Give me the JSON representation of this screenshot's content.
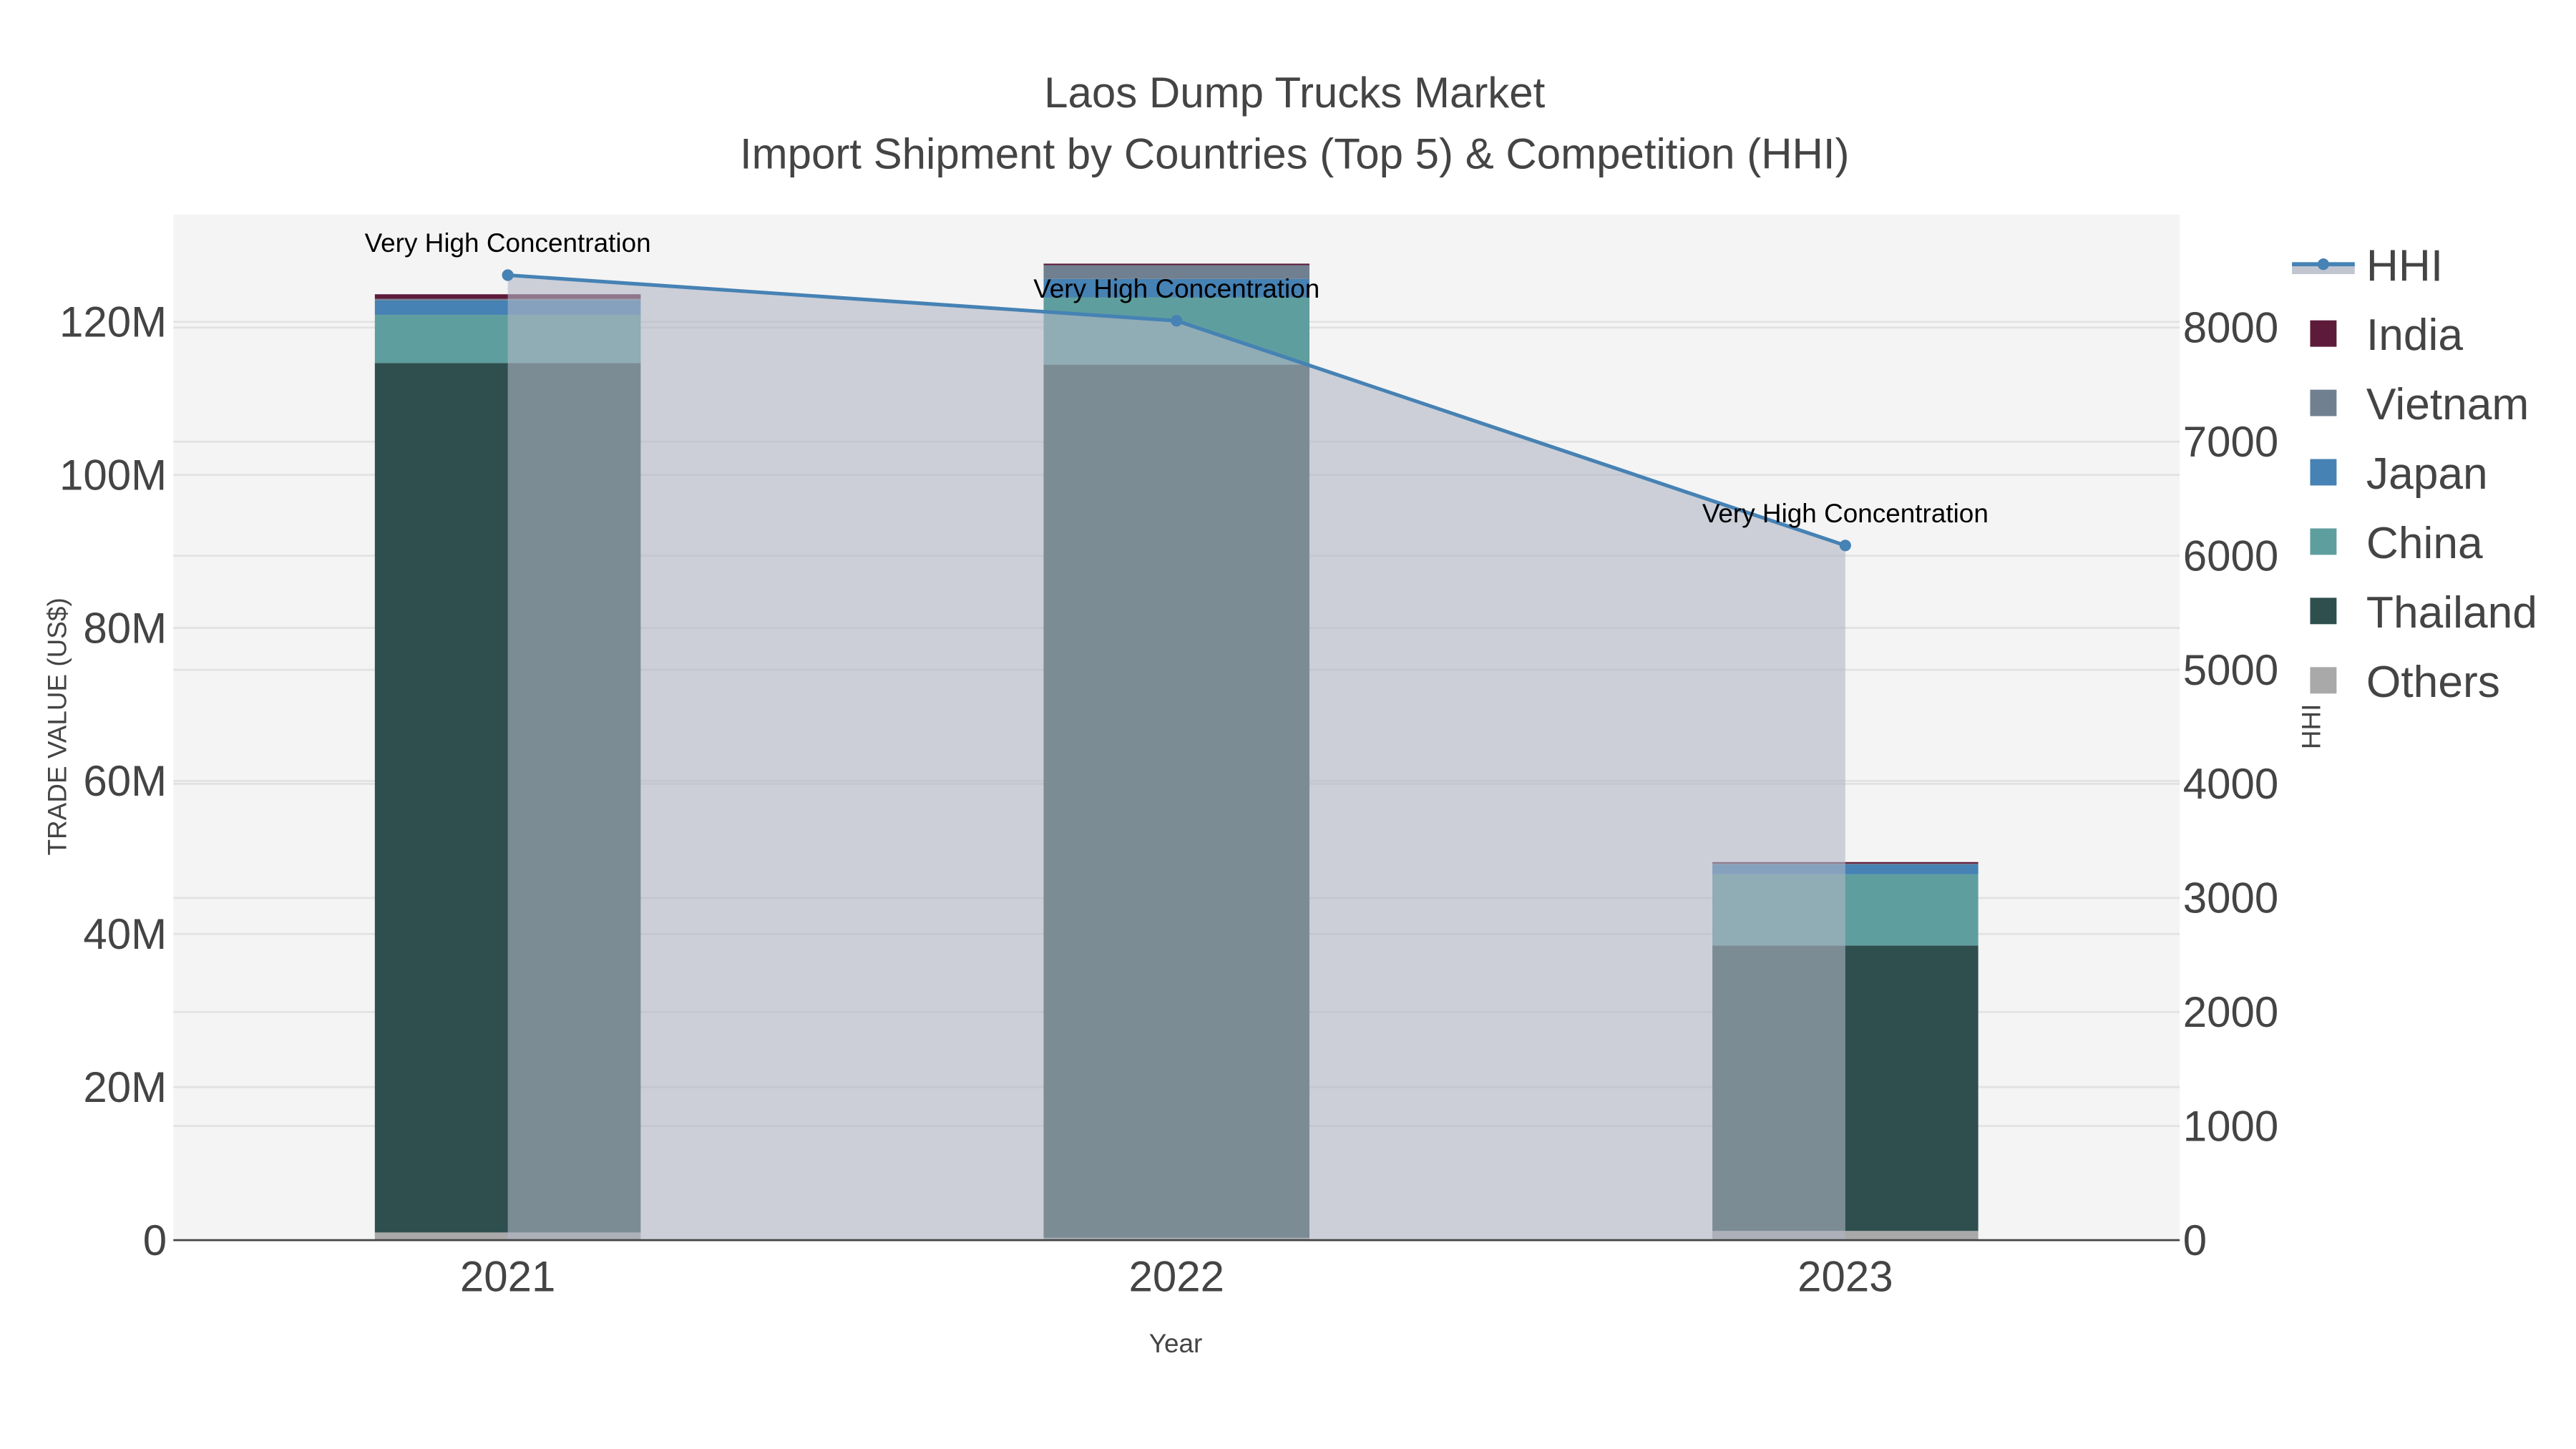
{
  "chart_data": {
    "type": "bar",
    "barmode": "stack",
    "title": "Laos Dump Trucks Market",
    "subtitle": "Import Shipment by Countries (Top 5) & Competition (HHI)",
    "xlabel": "Year",
    "ylabel": "TRADE VALUE (US$)",
    "y2label": "HHI",
    "categories": [
      "2021",
      "2022",
      "2023"
    ],
    "ylim": [
      0,
      134000000
    ],
    "y2lim": [
      0,
      8990
    ],
    "yticks": [
      0,
      20000000,
      40000000,
      60000000,
      80000000,
      100000000,
      120000000
    ],
    "ytick_labels": [
      "0",
      "20M",
      "40M",
      "60M",
      "80M",
      "100M",
      "120M"
    ],
    "y2ticks": [
      0,
      1000,
      2000,
      3000,
      4000,
      5000,
      6000,
      7000,
      8000
    ],
    "y2tick_labels": [
      "0",
      "1000",
      "2000",
      "3000",
      "4000",
      "5000",
      "6000",
      "7000",
      "8000"
    ],
    "grid": true,
    "legend_position": "right",
    "series": [
      {
        "name": "Others",
        "color": "#a9a9a9",
        "values": [
          1000000,
          300000,
          1200000
        ]
      },
      {
        "name": "Thailand",
        "color": "#2f4f4f",
        "values": [
          113600000,
          114100000,
          37300000
        ]
      },
      {
        "name": "China",
        "color": "#5f9e9e",
        "values": [
          6300000,
          8800000,
          9300000
        ]
      },
      {
        "name": "Japan",
        "color": "#4682b4",
        "values": [
          1900000,
          2400000,
          1300000
        ]
      },
      {
        "name": "Vietnam",
        "color": "#708090",
        "values": [
          200000,
          1800000,
          100000
        ]
      },
      {
        "name": "India",
        "color": "#5e1a3a",
        "values": [
          600000,
          200000,
          200000
        ]
      }
    ],
    "hhi": {
      "name": "HHI",
      "color": "#4682b4",
      "values": [
        8460,
        8060,
        6090
      ]
    },
    "annotations": [
      "Very High Concentration",
      "Very High Concentration",
      "Very High Concentration"
    ],
    "legend_order": [
      "HHI",
      "India",
      "Vietnam",
      "Japan",
      "China",
      "Thailand",
      "Others"
    ]
  }
}
